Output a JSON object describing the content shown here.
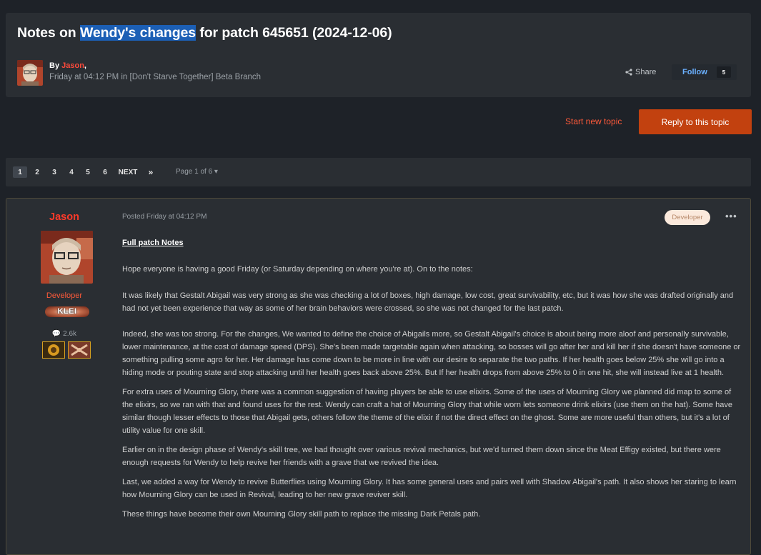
{
  "topic": {
    "title_before": "Notes on ",
    "title_highlight": "Wendy's changes",
    "title_after": " for patch 645651 (2024-12-06)",
    "by_prefix": "By ",
    "author": "Jason",
    "by_suffix": ",",
    "meta": "Friday at 04:12 PM in [Don't Starve Together] Beta Branch",
    "share_label": "Share",
    "follow_label": "Follow",
    "follow_count": "5"
  },
  "actions": {
    "start_new_topic": "Start new topic",
    "reply": "Reply to this topic"
  },
  "pagination": {
    "pages": [
      "1",
      "2",
      "3",
      "4",
      "5",
      "6"
    ],
    "next": "NEXT",
    "last": "»",
    "page_of": "Page 1 of 6 ▾"
  },
  "post": {
    "author": "Jason",
    "role": "Developer",
    "badge": "KLEI",
    "post_count": "2.6k",
    "posted": "Posted Friday at 04:12 PM",
    "developer_pill": "Developer",
    "more": "•••",
    "full_patch_notes": "Full patch Notes",
    "paragraphs": [
      "Hope everyone is having a good Friday (or Saturday depending on where you're at). On to the notes:",
      "It was likely that Gestalt Abigail was very strong as she was checking a lot of boxes, high damage, low cost, great survivability, etc, but it was how she was drafted originally and had not yet been experience that way as some of her brain behaviors were crossed, so she was not changed for the last patch.",
      "Indeed, she was too strong. For the changes, We wanted to define the choice of Abigails more, so Gestalt Abigail's choice is about being more aloof and personally survivable, lower maintenance, at the cost of damage speed (DPS). She's been made targetable again when attacking, so bosses will go after her and kill her if she doesn't have someone or something pulling some agro for her. Her damage has come down to be more in line with our desire to separate the two paths. If her health goes below 25% she will go into a hiding mode or pouting state and stop attacking until her health goes back above 25%. But If her health drops from above 25% to 0 in one hit, she will instead live at 1 health.",
      "For extra uses of Mourning Glory, there was a common suggestion of having players be able to use elixirs. Some of the uses of Mourning Glory we planned did map to some of the elixirs, so we ran with that and found uses for the rest. Wendy can craft a hat of Mourning Glory that while worn lets someone drink elixirs (use them on the hat). Some have similar though lesser effects to those that Abigail gets, others follow the theme of the elixir if not the direct effect on the ghost. Some are more useful than others, but it's a lot of utility value for one skill.",
      "Earlier on in the design phase of Wendy's skill tree, we had thought over various revival mechanics, but we'd turned them down since the Meat Effigy existed, but there were enough requests for Wendy to help revive her friends with a grave that we revived the idea.",
      "Last, we added a way for Wendy to revive Butterflies using Mourning Glory. It has some general uses and pairs well with Shadow Abigail's path. It also shows her staring to learn how Mourning Glory can be used in Revival, leading to her new grave reviver skill.",
      "These things have become their own Mourning Glory skill path to replace the missing Dark Petals path."
    ]
  }
}
